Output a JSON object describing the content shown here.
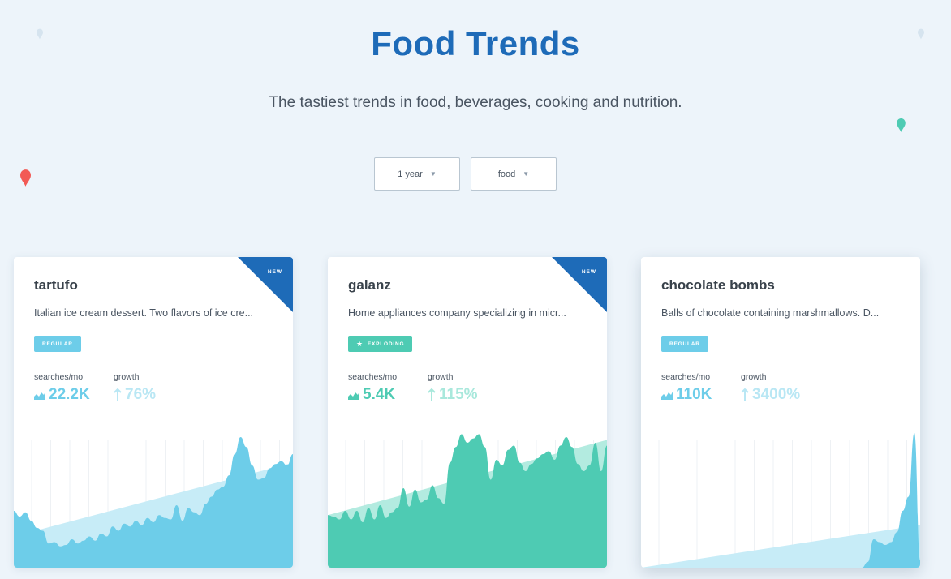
{
  "header": {
    "title": "Food Trends",
    "subtitle": "The tastiest trends in food, beverages, cooking and nutrition."
  },
  "filters": {
    "period": {
      "label": "1 year"
    },
    "category": {
      "label": "food"
    }
  },
  "colors": {
    "brand_blue": "#1e6bb8",
    "regular_blue": "#6dcde9",
    "exploding_green": "#4ecbb3",
    "growth_light": "#b9e7f4",
    "pin_red": "#f25a55",
    "pin_teal": "#4ecbb3"
  },
  "icons": [
    "chevron-down-icon",
    "map-pin-icon",
    "chart-area-icon",
    "arrow-up-icon",
    "star-icon"
  ],
  "cards": [
    {
      "title": "tartufo",
      "description": "Italian ice cream dessert. Two flavors of ice cre...",
      "badge": "NEW",
      "status": "REGULAR",
      "searches_label": "searches/mo",
      "searches_value": "22.2K",
      "growth_label": "growth",
      "growth_value": "76%",
      "series": [
        0.4,
        0.36,
        0.39,
        0.33,
        0.28,
        0.26,
        0.17,
        0.18,
        0.15,
        0.16,
        0.2,
        0.17,
        0.19,
        0.22,
        0.19,
        0.24,
        0.22,
        0.29,
        0.26,
        0.31,
        0.29,
        0.33,
        0.3,
        0.35,
        0.32,
        0.37,
        0.35,
        0.34,
        0.44,
        0.33,
        0.42,
        0.39,
        0.37,
        0.45,
        0.5,
        0.55,
        0.57,
        0.65,
        0.8,
        0.92,
        0.85,
        0.72,
        0.62,
        0.63,
        0.7,
        0.73,
        0.75,
        0.72,
        0.8
      ],
      "trend": [
        0.22,
        0.74
      ]
    },
    {
      "title": "galanz",
      "description": "Home appliances company specializing in micr...",
      "badge": "NEW",
      "status": "EXPLODING",
      "searches_label": "searches/mo",
      "searches_value": "5.4K",
      "growth_label": "growth",
      "growth_value": "115%",
      "series": [
        0.37,
        0.36,
        0.34,
        0.4,
        0.34,
        0.4,
        0.32,
        0.42,
        0.34,
        0.44,
        0.35,
        0.39,
        0.42,
        0.56,
        0.43,
        0.55,
        0.46,
        0.48,
        0.58,
        0.49,
        0.45,
        0.74,
        0.85,
        0.94,
        0.88,
        0.91,
        0.94,
        0.85,
        0.62,
        0.76,
        0.72,
        0.83,
        0.86,
        0.74,
        0.68,
        0.73,
        0.77,
        0.8,
        0.82,
        0.76,
        0.86,
        0.92,
        0.85,
        0.73,
        0.68,
        0.72,
        0.88,
        0.68,
        0.86
      ],
      "trend": [
        0.37,
        0.9
      ]
    },
    {
      "title": "chocolate bombs",
      "description": "Balls of chocolate containing marshmallows. D...",
      "badge": "",
      "status": "REGULAR",
      "searches_label": "searches/mo",
      "searches_value": "110K",
      "growth_label": "growth",
      "growth_value": "3400%",
      "series": [
        0,
        0,
        0,
        0,
        0,
        0,
        0,
        0,
        0,
        0,
        0,
        0,
        0,
        0,
        0,
        0,
        0,
        0,
        0,
        0,
        0,
        0,
        0,
        0,
        0,
        0,
        0,
        0,
        0,
        0,
        0,
        0,
        0,
        0,
        0,
        0,
        0,
        0,
        0,
        0.04,
        0.2,
        0.18,
        0.16,
        0.18,
        0.25,
        0.4,
        0.5,
        0.95,
        0.05
      ],
      "trend": [
        0.0,
        0.3
      ]
    }
  ]
}
